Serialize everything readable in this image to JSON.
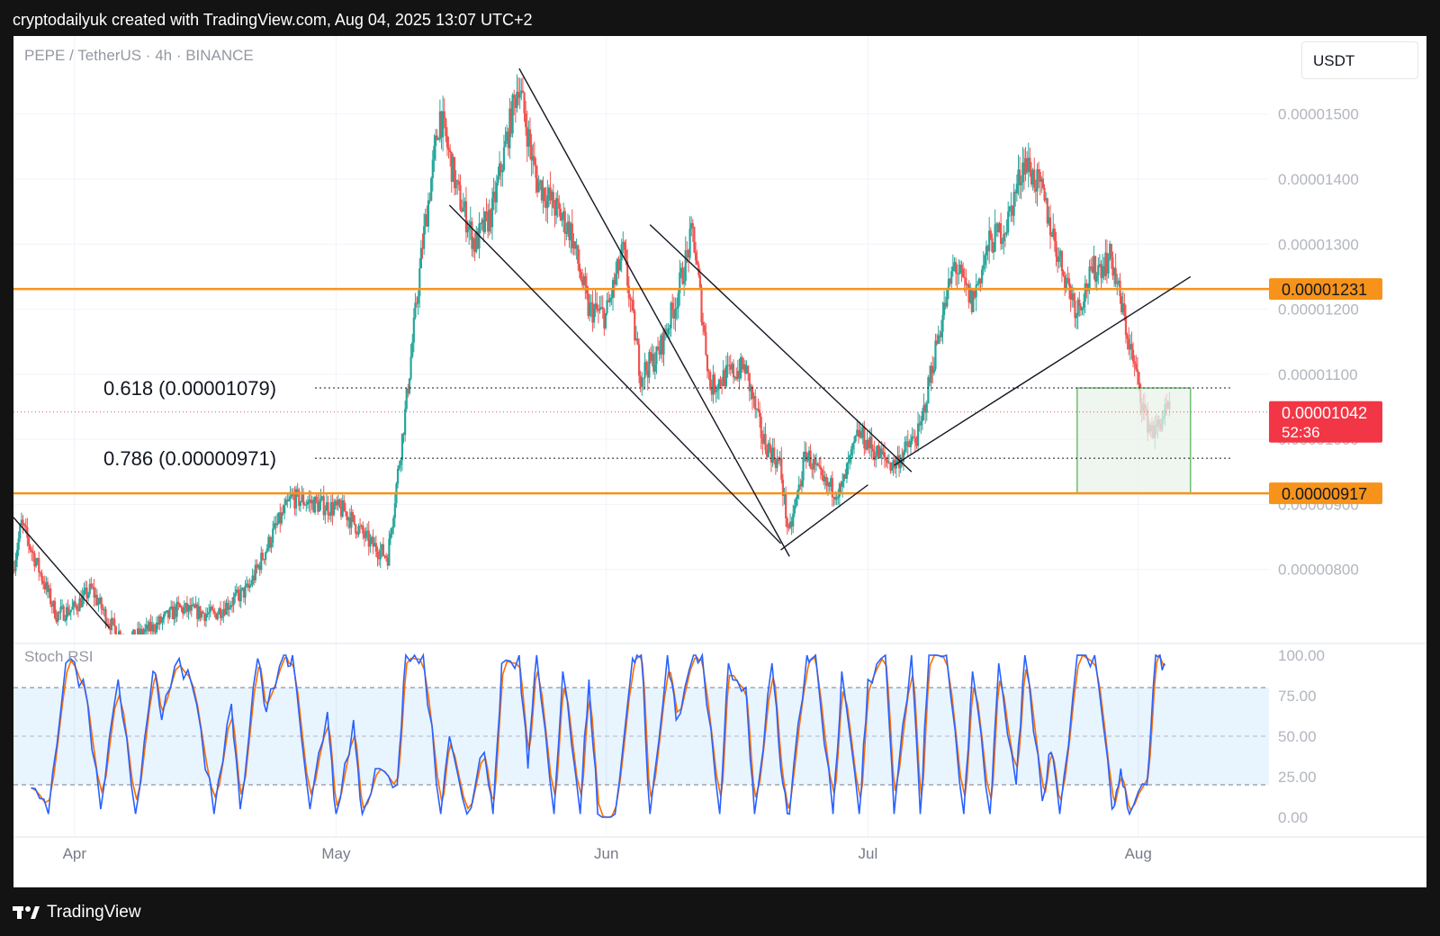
{
  "header": {
    "attribution": "cryptodailyuk created with TradingView.com, Aug 04, 2025 13:07 UTC+2"
  },
  "footer": {
    "brand": "TradingView"
  },
  "chart": {
    "symbol_title": "PEPE / TetherUS · 4h · BINANCE",
    "unit": "USDT",
    "oscillator_title": "Stoch RSI",
    "colors": {
      "up": "#26a69a",
      "down": "#ef5350",
      "level": "#f7931a",
      "stoch_k": "#2962ff",
      "stoch_d": "#ff6d00",
      "zone_fill": "#e9f2ea",
      "zone_border": "#4caf50"
    }
  },
  "chart_data": [
    {
      "type": "candlestick",
      "title": "PEPE / TetherUS · 4h · BINANCE",
      "y_unit": "USDT",
      "x_ticks": [
        "Apr",
        "May",
        "Jun",
        "Jul",
        "Aug"
      ],
      "x_range": [
        "2025-03-25",
        "2025-08-16"
      ],
      "y_ticks": [
        "0.00000800",
        "0.00000900",
        "0.00001000",
        "0.00001100",
        "0.00001200",
        "0.00001300",
        "0.00001400",
        "0.00001500"
      ],
      "ylim": [
        7e-06,
        1.62e-05
      ],
      "path_points": [
        [
          "2025-03-25",
          8e-06
        ],
        [
          "2025-03-26",
          8.7e-06
        ],
        [
          "2025-03-28",
          8e-06
        ],
        [
          "2025-03-30",
          7.3e-06
        ],
        [
          "2025-04-01",
          7.4e-06
        ],
        [
          "2025-04-03",
          7.7e-06
        ],
        [
          "2025-04-05",
          7.2e-06
        ],
        [
          "2025-04-07",
          6.9e-06
        ],
        [
          "2025-04-10",
          7.1e-06
        ],
        [
          "2025-04-13",
          7.4e-06
        ],
        [
          "2025-04-17",
          7.3e-06
        ],
        [
          "2025-04-21",
          7.7e-06
        ],
        [
          "2025-04-24",
          8.6e-06
        ],
        [
          "2025-04-26",
          9.1e-06
        ],
        [
          "2025-04-29",
          9e-06
        ],
        [
          "2025-05-02",
          8.9e-06
        ],
        [
          "2025-05-05",
          8.4e-06
        ],
        [
          "2025-05-07",
          8.2e-06
        ],
        [
          "2025-05-09",
          1.04e-05
        ],
        [
          "2025-05-11",
          1.3e-05
        ],
        [
          "2025-05-13",
          1.5e-05
        ],
        [
          "2025-05-15",
          1.38e-05
        ],
        [
          "2025-05-17",
          1.3e-05
        ],
        [
          "2025-05-19",
          1.35e-05
        ],
        [
          "2025-05-22",
          1.55e-05
        ],
        [
          "2025-05-24",
          1.4e-05
        ],
        [
          "2025-05-26",
          1.36e-05
        ],
        [
          "2025-05-28",
          1.32e-05
        ],
        [
          "2025-05-30",
          1.2e-05
        ],
        [
          "2025-06-01",
          1.19e-05
        ],
        [
          "2025-06-03",
          1.29e-05
        ],
        [
          "2025-06-05",
          1.1e-05
        ],
        [
          "2025-06-07",
          1.13e-05
        ],
        [
          "2025-06-09",
          1.21e-05
        ],
        [
          "2025-06-11",
          1.32e-05
        ],
        [
          "2025-06-13",
          1.08e-05
        ],
        [
          "2025-06-15",
          1.1e-05
        ],
        [
          "2025-06-17",
          1.11e-05
        ],
        [
          "2025-06-19",
          1e-05
        ],
        [
          "2025-06-21",
          9.6e-06
        ],
        [
          "2025-06-22",
          8.5e-06
        ],
        [
          "2025-06-24",
          9.8e-06
        ],
        [
          "2025-06-26",
          9.3e-06
        ],
        [
          "2025-06-28",
          9.2e-06
        ],
        [
          "2025-06-30",
          1.01e-05
        ],
        [
          "2025-07-02",
          9.8e-06
        ],
        [
          "2025-07-04",
          9.6e-06
        ],
        [
          "2025-07-07",
          1.01e-05
        ],
        [
          "2025-07-09",
          1.15e-05
        ],
        [
          "2025-07-11",
          1.27e-05
        ],
        [
          "2025-07-13",
          1.21e-05
        ],
        [
          "2025-07-15",
          1.3e-05
        ],
        [
          "2025-07-17",
          1.33e-05
        ],
        [
          "2025-07-19",
          1.43e-05
        ],
        [
          "2025-07-21",
          1.38e-05
        ],
        [
          "2025-07-23",
          1.28e-05
        ],
        [
          "2025-07-25",
          1.2e-05
        ],
        [
          "2025-07-27",
          1.26e-05
        ],
        [
          "2025-07-29",
          1.28e-05
        ],
        [
          "2025-07-31",
          1.15e-05
        ],
        [
          "2025-08-02",
          1.03e-05
        ],
        [
          "2025-08-03",
          1.01e-05
        ],
        [
          "2025-08-04",
          1.04e-05
        ]
      ],
      "levels": [
        {
          "value": 1.231e-05,
          "label": "0.00001231"
        },
        {
          "value": 9.17e-06,
          "label": "0.00000917"
        }
      ],
      "fib_levels": [
        {
          "value": 1.079e-05,
          "label": "0.618 (0.00001079)"
        },
        {
          "value": 9.71e-06,
          "label": "0.786 (0.00000971)"
        }
      ],
      "last_price": {
        "value": 1.042e-05,
        "label": "0.00001042",
        "countdown": "52:36"
      },
      "trendlines": [
        {
          "from": [
            "2025-03-25",
            8.8e-06
          ],
          "to": [
            "2025-04-05",
            7.1e-06
          ]
        },
        {
          "from": [
            "2025-05-22",
            1.57e-05
          ],
          "to": [
            "2025-06-22",
            8.2e-06
          ]
        },
        {
          "from": [
            "2025-05-14",
            1.36e-05
          ],
          "to": [
            "2025-06-21",
            8.4e-06
          ]
        },
        {
          "from": [
            "2025-06-21",
            8.3e-06
          ],
          "to": [
            "2025-07-01",
            9.3e-06
          ]
        },
        {
          "from": [
            "2025-06-06",
            1.33e-05
          ],
          "to": [
            "2025-07-06",
            9.5e-06
          ]
        },
        {
          "from": [
            "2025-07-04",
            9.6e-06
          ],
          "to": [
            "2025-08-07",
            1.25e-05
          ]
        }
      ],
      "zone": {
        "x_range": [
          "2025-07-25",
          "2025-08-07"
        ],
        "y_range": [
          9.17e-06,
          1.079e-05
        ]
      }
    },
    {
      "type": "line",
      "title": "Stoch RSI",
      "y_ticks": [
        "0.00",
        "25.00",
        "50.00",
        "75.00",
        "100.00"
      ],
      "ylim": [
        0,
        100
      ],
      "bands": [
        20,
        80
      ],
      "series": [],
      "x_range": [
        "2025-03-25",
        "2025-08-04"
      ],
      "cycle_peaks": [
        [
          "2025-03-27",
          18
        ],
        [
          "2025-03-29",
          2
        ],
        [
          "2025-03-31",
          95
        ],
        [
          "2025-04-02",
          85
        ],
        [
          "2025-04-04",
          5
        ],
        [
          "2025-04-06",
          85
        ],
        [
          "2025-04-08",
          2
        ],
        [
          "2025-04-10",
          90
        ],
        [
          "2025-04-11",
          60
        ],
        [
          "2025-04-13",
          98
        ],
        [
          "2025-04-15",
          70
        ],
        [
          "2025-04-17",
          2
        ],
        [
          "2025-04-19",
          70
        ],
        [
          "2025-04-20",
          5
        ],
        [
          "2025-04-22",
          98
        ],
        [
          "2025-04-23",
          65
        ],
        [
          "2025-04-25",
          100
        ],
        [
          "2025-04-26",
          100
        ],
        [
          "2025-04-28",
          5
        ],
        [
          "2025-04-30",
          65
        ],
        [
          "2025-05-01",
          2
        ],
        [
          "2025-05-03",
          60
        ],
        [
          "2025-05-04",
          2
        ],
        [
          "2025-05-06",
          30
        ],
        [
          "2025-05-08",
          20
        ],
        [
          "2025-05-09",
          100
        ],
        [
          "2025-05-11",
          100
        ],
        [
          "2025-05-13",
          2
        ],
        [
          "2025-05-14",
          50
        ],
        [
          "2025-05-16",
          2
        ],
        [
          "2025-05-18",
          40
        ],
        [
          "2025-05-19",
          2
        ],
        [
          "2025-05-20",
          95
        ],
        [
          "2025-05-22",
          100
        ],
        [
          "2025-05-23",
          30
        ],
        [
          "2025-05-24",
          100
        ],
        [
          "2025-05-26",
          2
        ],
        [
          "2025-05-27",
          90
        ],
        [
          "2025-05-29",
          2
        ],
        [
          "2025-05-30",
          85
        ],
        [
          "2025-05-31",
          2
        ],
        [
          "2025-06-02",
          2
        ],
        [
          "2025-06-04",
          98
        ],
        [
          "2025-06-05",
          100
        ],
        [
          "2025-06-06",
          2
        ],
        [
          "2025-06-08",
          100
        ],
        [
          "2025-06-09",
          60
        ],
        [
          "2025-06-11",
          100
        ],
        [
          "2025-06-12",
          100
        ],
        [
          "2025-06-14",
          2
        ],
        [
          "2025-06-15",
          95
        ],
        [
          "2025-06-17",
          80
        ],
        [
          "2025-06-18",
          2
        ],
        [
          "2025-06-20",
          95
        ],
        [
          "2025-06-21",
          30
        ],
        [
          "2025-06-22",
          2
        ],
        [
          "2025-06-24",
          100
        ],
        [
          "2025-06-25",
          100
        ],
        [
          "2025-06-27",
          2
        ],
        [
          "2025-06-28",
          90
        ],
        [
          "2025-06-30",
          2
        ],
        [
          "2025-07-01",
          85
        ],
        [
          "2025-07-03",
          100
        ],
        [
          "2025-07-04",
          2
        ],
        [
          "2025-07-06",
          100
        ],
        [
          "2025-07-07",
          2
        ],
        [
          "2025-07-08",
          100
        ],
        [
          "2025-07-10",
          100
        ],
        [
          "2025-07-12",
          2
        ],
        [
          "2025-07-13",
          90
        ],
        [
          "2025-07-15",
          2
        ],
        [
          "2025-07-16",
          95
        ],
        [
          "2025-07-18",
          20
        ],
        [
          "2025-07-19",
          100
        ],
        [
          "2025-07-21",
          10
        ],
        [
          "2025-07-22",
          40
        ],
        [
          "2025-07-23",
          2
        ],
        [
          "2025-07-25",
          100
        ],
        [
          "2025-07-27",
          100
        ],
        [
          "2025-07-29",
          5
        ],
        [
          "2025-07-30",
          30
        ],
        [
          "2025-07-31",
          2
        ],
        [
          "2025-08-02",
          20
        ],
        [
          "2025-08-03",
          100
        ],
        [
          "2025-08-04",
          95
        ]
      ]
    }
  ]
}
